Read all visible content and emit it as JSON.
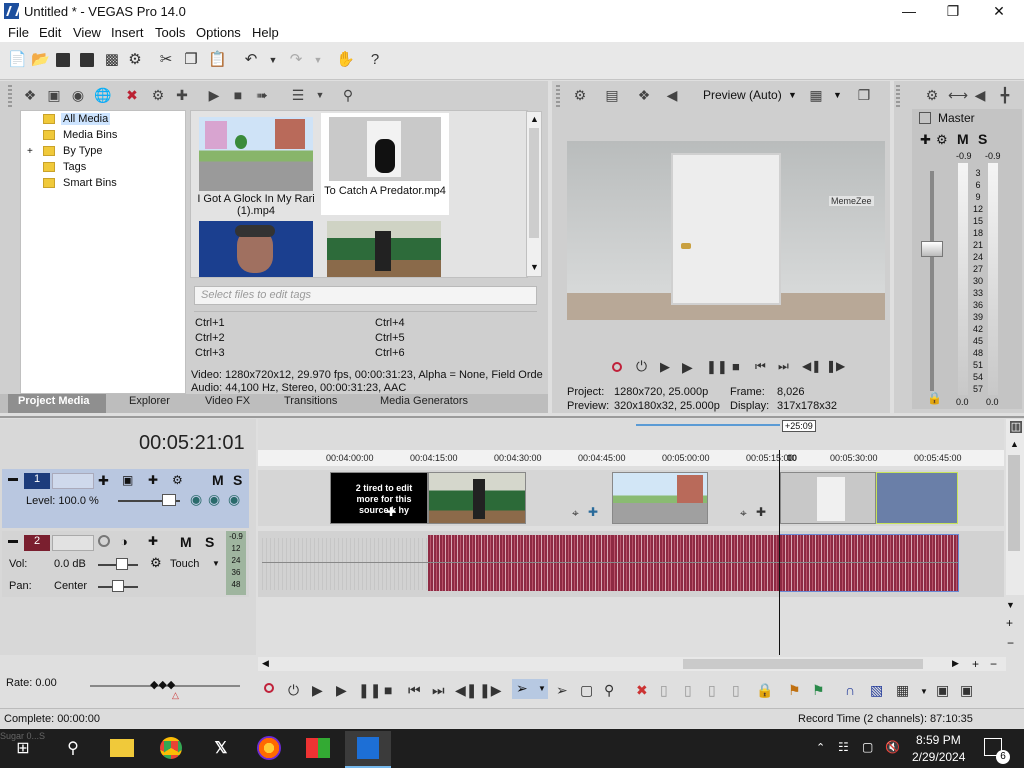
{
  "window": {
    "title": "Untitled * - VEGAS Pro 14.0",
    "min": "—",
    "max": "❐",
    "close": "✕"
  },
  "menu": [
    "File",
    "Edit",
    "View",
    "Insert",
    "Tools",
    "Options",
    "Help"
  ],
  "project_media": {
    "tree": [
      "All Media",
      "Media Bins",
      "By Type",
      "Tags",
      "Smart Bins"
    ],
    "expander": "+",
    "items": [
      {
        "name": "I Got A Glock In My Rari (1).mp4"
      },
      {
        "name": "To Catch A Predator.mp4"
      }
    ],
    "tags_placeholder": "Select files to edit tags",
    "shortcuts": [
      "Ctrl+1",
      "Ctrl+2",
      "Ctrl+3",
      "Ctrl+4",
      "Ctrl+5",
      "Ctrl+6"
    ],
    "info_line1": "Video: 1280x720x12, 29.970 fps, 00:00:31:23, Alpha = None, Field Orde",
    "info_line2": "Audio: 44,100 Hz, Stereo, 00:00:31:23, AAC"
  },
  "tabs": [
    "Project Media",
    "Explorer",
    "Video FX",
    "Transitions",
    "Media Generators"
  ],
  "preview": {
    "mode": "Preview (Auto)",
    "watermark": "MemeZee",
    "project_label": "Project:",
    "project_value": "1280x720, 25.000p",
    "preview_label": "Preview:",
    "preview_value": "320x180x32, 25.000p",
    "frame_label": "Frame:",
    "frame_value": "8,026",
    "display_label": "Display:",
    "display_value": "317x178x32"
  },
  "master": {
    "label": "Master",
    "m": "M",
    "s": "S",
    "peak_left": "-0.9",
    "peak_right": "-0.9",
    "scale": [
      "3",
      "6",
      "9",
      "12",
      "15",
      "18",
      "21",
      "24",
      "27",
      "30",
      "33",
      "36",
      "39",
      "42",
      "45",
      "48",
      "51",
      "54",
      "57"
    ],
    "bottom_left": "0.0",
    "bottom_right": "0.0"
  },
  "timeline": {
    "timecode": "00:05:21:01",
    "offset_badge": "+25:09",
    "ruler": [
      "00:04:00:00",
      "00:04:15:00",
      "00:04:30:00",
      "00:04:45:00",
      "00:05:00:00",
      "00:05:15:00",
      "00:05:30:00",
      "00:05:45:00"
    ],
    "ruler_cut": "00:05:",
    "cursor_label": "00",
    "track1": {
      "num": "1",
      "level": "Level: 100.0 %",
      "m": "M",
      "s": "S"
    },
    "track2": {
      "num": "2",
      "vol_label": "Vol:",
      "vol": "0.0 dB",
      "pan_label": "Pan:",
      "pan": "Center",
      "mode": "Touch",
      "m": "M",
      "s": "S",
      "meter": [
        "-0.9",
        "12",
        "24",
        "36",
        "48"
      ]
    },
    "clip_text": "2 tired to edit more for this source k hy",
    "rate": "Rate: 0.00"
  },
  "status": {
    "complete": "Complete: 00:00:00",
    "record": "Record Time (2 channels): 87:10:35"
  },
  "taskbar": {
    "time": "8:59 PM",
    "date": "2/29/2024",
    "badge": "6",
    "cut_text": "Sugar 0...S"
  }
}
